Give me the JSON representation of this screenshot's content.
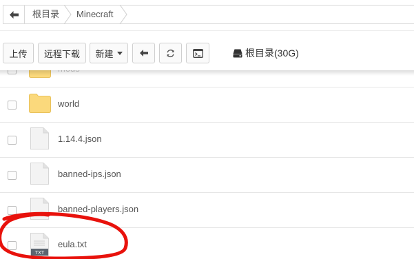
{
  "breadcrumb": {
    "items": [
      "根目录",
      "Minecraft"
    ]
  },
  "toolbar": {
    "upload_label": "上传",
    "remote_download_label": "远程下载",
    "new_label": "新建",
    "disk_label": "根目录(30G)"
  },
  "files": [
    {
      "name": "mods",
      "type": "folder"
    },
    {
      "name": "world",
      "type": "folder"
    },
    {
      "name": "1.14.4.json",
      "type": "file"
    },
    {
      "name": "banned-ips.json",
      "type": "file"
    },
    {
      "name": "banned-players.json",
      "type": "file"
    },
    {
      "name": "eula.txt",
      "type": "txt",
      "badge": "TXT"
    }
  ],
  "colors": {
    "folder": "#fbd97c",
    "folder_border": "#e9c25c",
    "annotation": "#e8120c"
  },
  "icons": {
    "back": "arrow-left-icon",
    "refresh": "refresh-icon",
    "terminal": "terminal-icon",
    "disk": "hard-drive-icon"
  }
}
